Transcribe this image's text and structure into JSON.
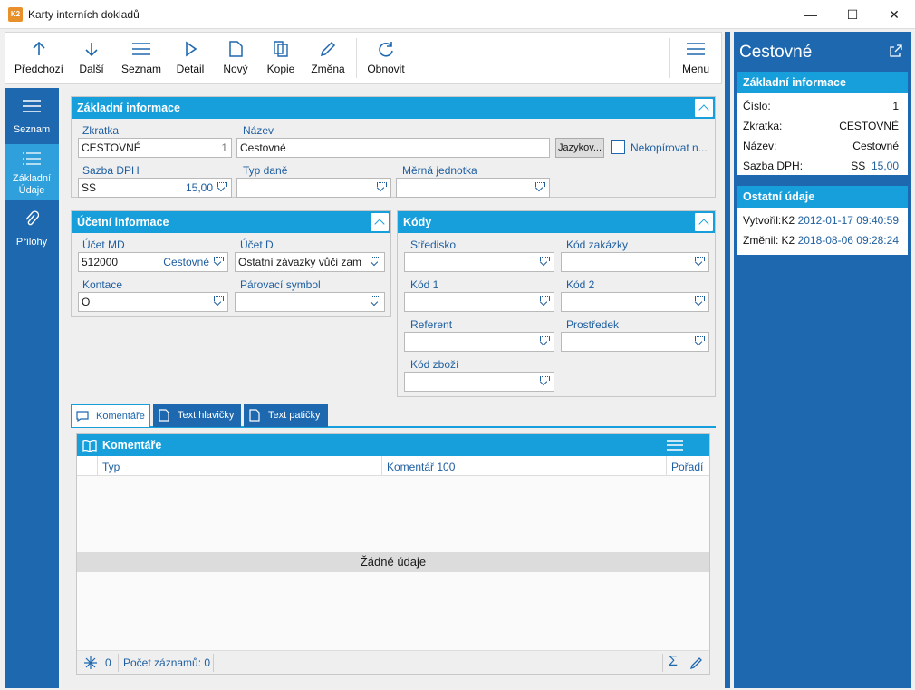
{
  "window": {
    "title": "Karty interních dokladů",
    "app_icon": "K2",
    "minimize": "—",
    "maximize": "☐",
    "close": "✕"
  },
  "toolbar": {
    "prev": "Předchozí",
    "next": "Další",
    "list": "Seznam",
    "detail": "Detail",
    "new": "Nový",
    "copy": "Kopie",
    "change": "Změna",
    "refresh": "Obnovit",
    "menu": "Menu"
  },
  "nav": {
    "list": "Seznam",
    "basic": "Základní\nÚdaje",
    "attachments": "Přílohy"
  },
  "basic_info": {
    "title": "Základní informace",
    "abbr_label": "Zkratka",
    "abbr_value": "CESTOVNÉ",
    "abbr_num": "1",
    "name_label": "Název",
    "name_value": "Cestovné",
    "lang_button": "Jazykov...",
    "nocopy_label": "Nekopírovat n...",
    "vat_label": "Sazba DPH",
    "vat_code": "SS",
    "vat_rate": "15,00",
    "taxtype_label": "Typ daně",
    "taxtype_value": "",
    "unit_label": "Měrná jednotka",
    "unit_value": ""
  },
  "accounting": {
    "title": "Účetní informace",
    "md_label": "Účet MD",
    "md_value": "512000",
    "md_name": "Cestovné",
    "d_label": "Účet D",
    "d_value": "Ostatní závazky vůči zam",
    "contact_label": "Kontace",
    "contact_value": "O",
    "pair_label": "Párovací symbol",
    "pair_value": ""
  },
  "codes": {
    "title": "Kódy",
    "center": "Středisko",
    "order": "Kód zakázky",
    "code1": "Kód 1",
    "code2": "Kód 2",
    "referent": "Referent",
    "means": "Prostředek",
    "goods": "Kód zboží"
  },
  "tabs": [
    "Komentáře",
    "Text hlavičky",
    "Text patičky"
  ],
  "comments": {
    "title": "Komentáře",
    "col_type": "Typ",
    "col_comment": "Komentář 100",
    "col_order": "Pořadí",
    "empty": "Žádné údaje",
    "count_num": "0",
    "records": "Počet záznamů: 0"
  },
  "right": {
    "title": "Cestovné",
    "basic_title": "Základní informace",
    "number_label": "Číslo:",
    "number_value": "1",
    "abbr_label": "Zkratka:",
    "abbr_value": "CESTOVNÉ",
    "name_label": "Název:",
    "name_value": "Cestovné",
    "vat_label": "Sazba DPH:",
    "vat_code": "SS",
    "vat_rate": "15,00",
    "other_title": "Ostatní údaje",
    "created_label": "Vytvořil:",
    "created_user": "K2",
    "created_date": "2012-01-17 09:40:59",
    "changed_label": "Změnil:",
    "changed_user": "K2",
    "changed_date": "2018-08-06 09:28:24"
  },
  "colors": {
    "accent": "#179fdc",
    "nav": "#1e68b0",
    "label": "#1f5fa0"
  }
}
